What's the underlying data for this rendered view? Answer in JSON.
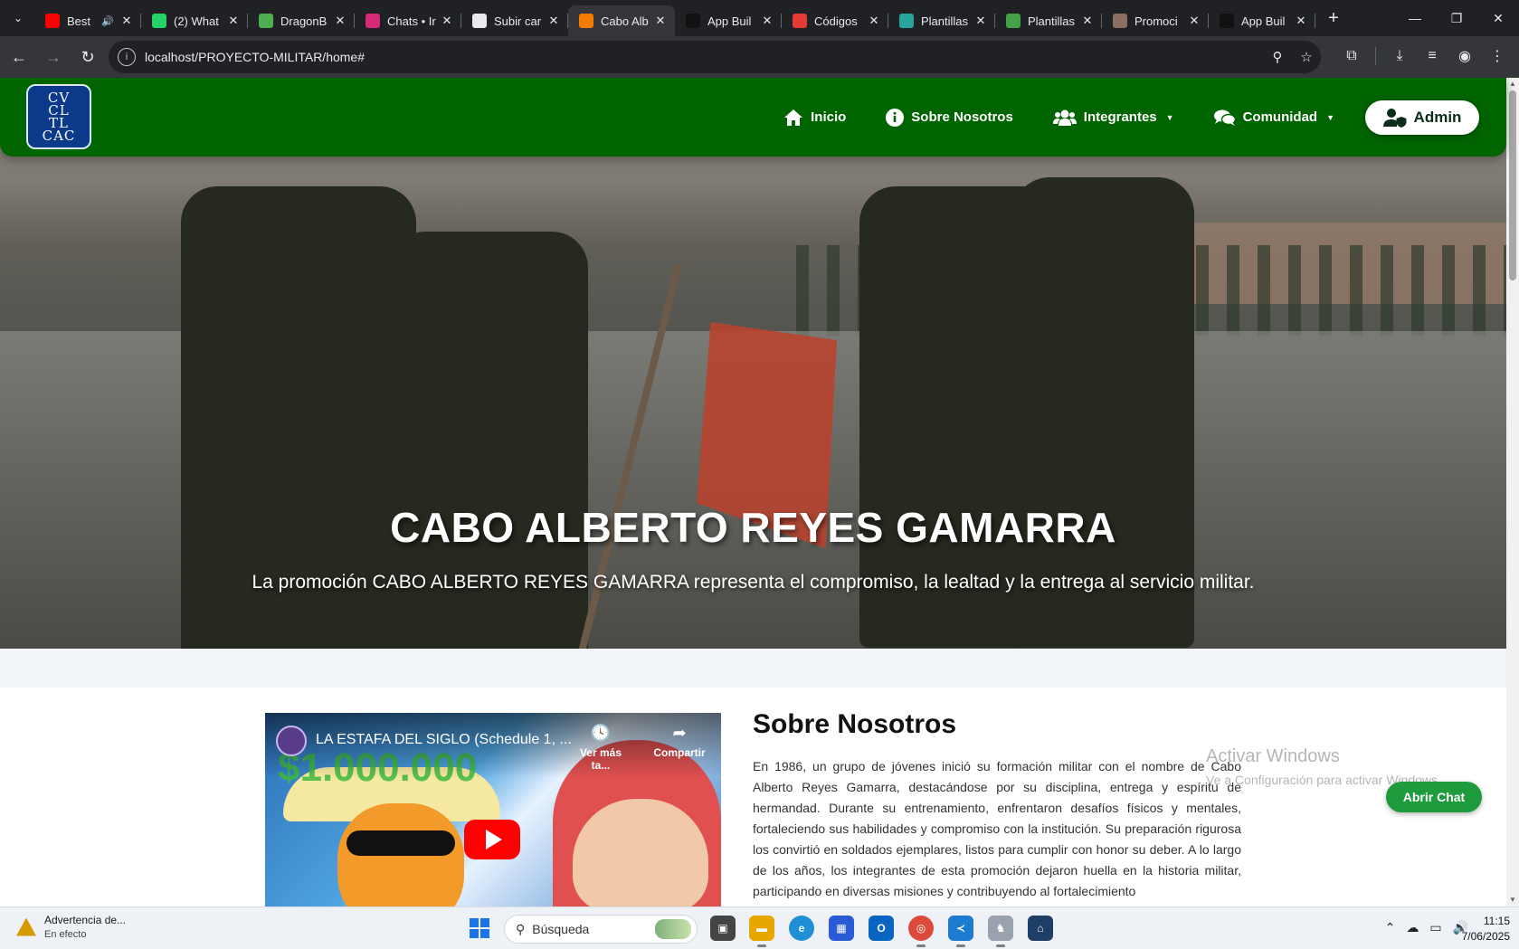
{
  "browser": {
    "tabs": [
      {
        "title": "Best",
        "favicon": "youtube-favicon",
        "color": "#ff0000",
        "audio": true
      },
      {
        "title": "(2) What",
        "favicon": "whatsapp-favicon",
        "color": "#25d366"
      },
      {
        "title": "DragonB",
        "favicon": "dragonball-favicon",
        "color": "#4caf50"
      },
      {
        "title": "Chats • Ir",
        "favicon": "instagram-favicon",
        "color": "#d62976"
      },
      {
        "title": "Subir car",
        "favicon": "openai-favicon",
        "color": "#e8eaed"
      },
      {
        "title": "Cabo Alb",
        "favicon": "site-favicon",
        "color": "#f57c00",
        "active": true
      },
      {
        "title": "App Buil",
        "favicon": "app-builder-favicon",
        "color": "#111111"
      },
      {
        "title": "Códigos",
        "favicon": "codigos-favicon",
        "color": "#e53935"
      },
      {
        "title": "Plantillas",
        "favicon": "plantillas-favicon",
        "color": "#26a69a"
      },
      {
        "title": "Plantillas",
        "favicon": "plantillas-green-favicon",
        "color": "#43a047"
      },
      {
        "title": "Promoci",
        "favicon": "promocion-favicon",
        "color": "#8d6e63"
      },
      {
        "title": "App Buil",
        "favicon": "app-builder-favicon",
        "color": "#111111"
      }
    ],
    "url": "localhost/PROYECTO-MILITAR/home#"
  },
  "site": {
    "logo_text": "CV CL TL CAC",
    "nav": {
      "inicio": "Inicio",
      "sobre": "Sobre Nosotros",
      "integrantes": "Integrantes",
      "comunidad": "Comunidad",
      "admin": "Admin"
    },
    "hero": {
      "title": "CABO ALBERTO REYES GAMARRA",
      "subtitle": "La promoción CABO ALBERTO REYES GAMARRA representa el compromiso, la lealtad y la entrega al servicio militar."
    },
    "video": {
      "title": "LA ESTAFA DEL SIGLO (Schedule 1, ...",
      "watch_later": "Ver más ta...",
      "share": "Compartir",
      "overlay_text": "$1.000.000"
    },
    "about": {
      "title": "Sobre Nosotros",
      "body": "En 1986, un grupo de jóvenes inició su formación militar con el nombre de Cabo Alberto Reyes Gamarra, destacándose por su disciplina, entrega y espíritu de hermandad. Durante su entrenamiento, enfrentaron desafíos físicos y mentales, fortaleciendo sus habilidades y compromiso con la institución. Su preparación rigurosa los convirtió en soldados ejemplares, listos para cumplir con honor su deber. A lo largo de los años, los integrantes de esta promoción dejaron huella en la historia militar, participando en diversas misiones y contribuyendo al fortalecimiento"
    },
    "chat_button": "Abrir Chat",
    "accent_green": "#006400"
  },
  "watermark": {
    "line1": "Activar Windows",
    "line2": "Ve a Configuración para activar Windows."
  },
  "taskbar": {
    "notification_title": "Advertencia de...",
    "notification_sub": "En efecto",
    "search_placeholder": "Búsqueda",
    "time": "11:15",
    "date": "7/06/2025"
  }
}
